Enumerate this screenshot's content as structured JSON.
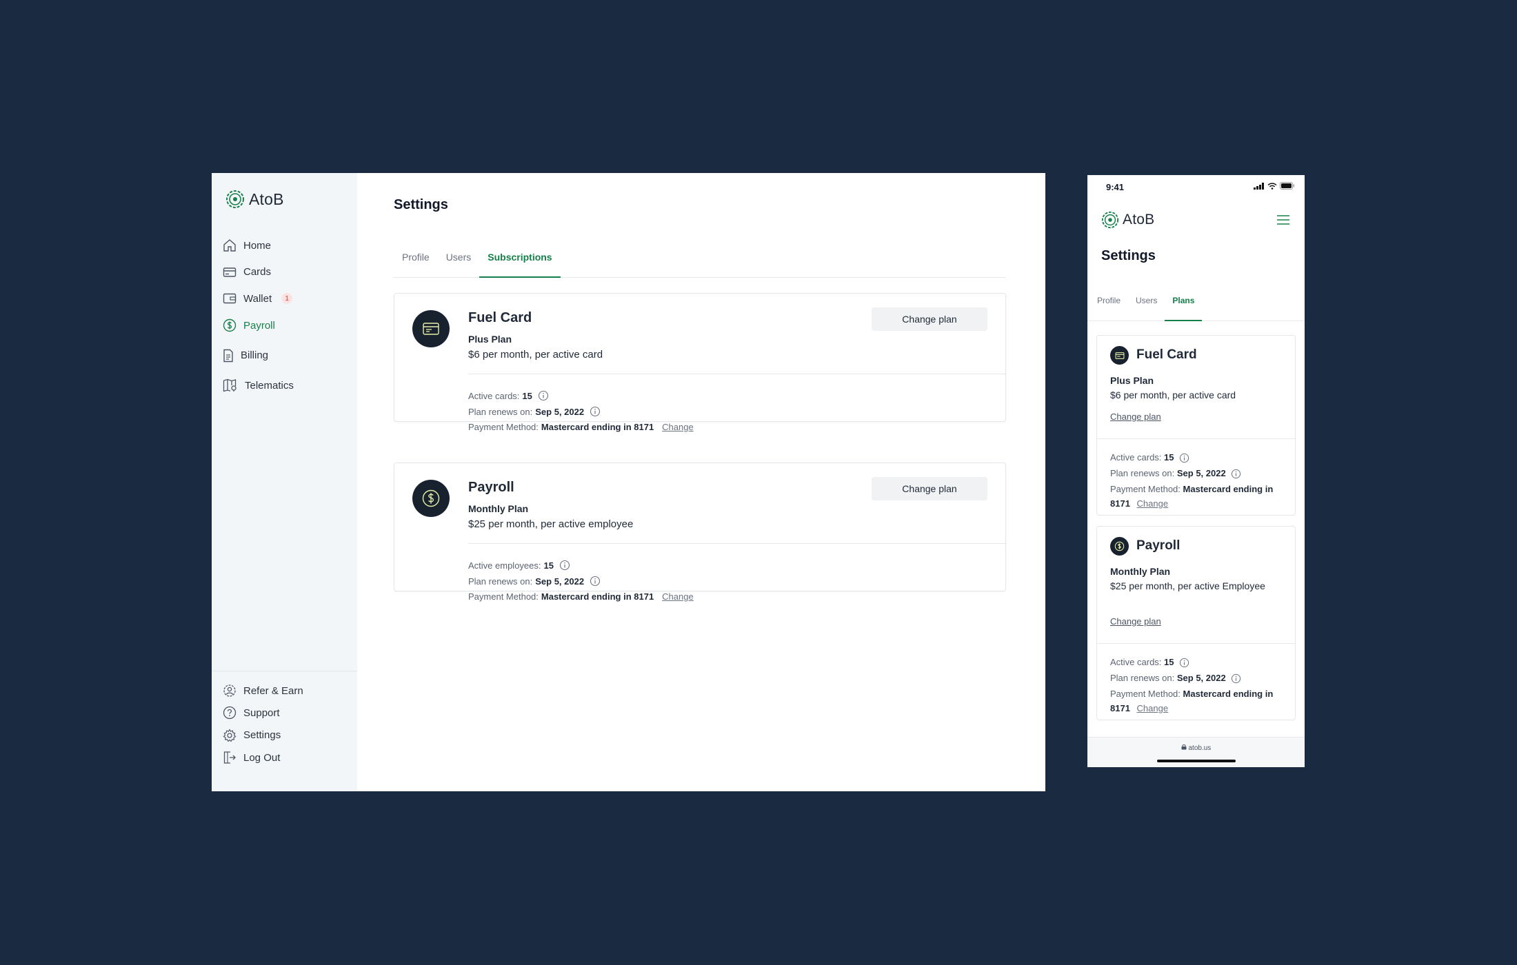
{
  "brand": {
    "name": "AtoB",
    "accent": "#16804a"
  },
  "sidebar": {
    "items": [
      {
        "label": "Home",
        "icon": "home-icon"
      },
      {
        "label": "Cards",
        "icon": "card-icon"
      },
      {
        "label": "Wallet",
        "icon": "wallet-icon",
        "badge": "1"
      },
      {
        "label": "Payroll",
        "icon": "dollar-circle-icon",
        "active": true
      },
      {
        "label": "Billing",
        "icon": "document-icon"
      },
      {
        "label": "Telematics",
        "icon": "map-icon"
      }
    ],
    "bottom_items": [
      {
        "label": "Refer & Earn",
        "icon": "gift-icon"
      },
      {
        "label": "Support",
        "icon": "help-icon"
      },
      {
        "label": "Settings",
        "icon": "gear-icon"
      },
      {
        "label": "Log Out",
        "icon": "logout-icon"
      }
    ]
  },
  "main": {
    "title": "Settings",
    "tabs": [
      {
        "label": "Profile"
      },
      {
        "label": "Users"
      },
      {
        "label": "Subscriptions",
        "active": true
      }
    ],
    "cards": [
      {
        "title": "Fuel Card",
        "plan": "Plus Plan",
        "price": "$6 per month, per active card",
        "button": "Change plan",
        "details": [
          {
            "label": "Active cards:",
            "value": "15"
          },
          {
            "label": "Plan renews on:",
            "value": "Sep 5, 2022"
          },
          {
            "label": "Payment Method:",
            "value": "Mastercard ending in 8171",
            "link": "Change"
          }
        ]
      },
      {
        "title": "Payroll",
        "plan": "Monthly Plan",
        "price": "$25 per month, per active employee",
        "button": "Change plan",
        "details": [
          {
            "label": "Active employees:",
            "value": "15"
          },
          {
            "label": "Plan renews on:",
            "value": "Sep 5, 2022"
          },
          {
            "label": "Payment Method:",
            "value": "Mastercard ending in 8171",
            "link": "Change"
          }
        ]
      }
    ]
  },
  "mobile": {
    "time": "9:41",
    "title": "Settings",
    "tabs": [
      {
        "label": "Profile"
      },
      {
        "label": "Users"
      },
      {
        "label": "Plans",
        "active": true
      }
    ],
    "cards": [
      {
        "title": "Fuel Card",
        "plan": "Plus Plan",
        "price": "$6 per month, per active card",
        "link": "Change plan",
        "details": [
          {
            "label": "Active cards:",
            "value": "15"
          },
          {
            "label": "Plan renews on:",
            "value": "Sep 5, 2022"
          },
          {
            "label": "Payment Method:",
            "value": "Mastercard ending in 8171",
            "link": "Change"
          }
        ]
      },
      {
        "title": "Payroll",
        "plan": "Monthly Plan",
        "price": "$25 per month, per active Employee",
        "link": "Change plan",
        "details": [
          {
            "label": "Active cards:",
            "value": "15"
          },
          {
            "label": "Plan renews on:",
            "value": "Sep 5, 2022"
          },
          {
            "label": "Payment Method:",
            "value": "Mastercard ending in 8171",
            "link": "Change"
          }
        ]
      }
    ],
    "url": "atob.us"
  }
}
